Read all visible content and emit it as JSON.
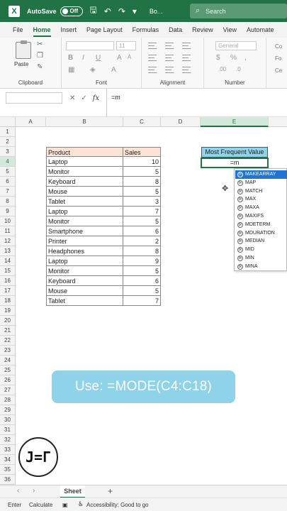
{
  "titlebar": {
    "autosave_label": "AutoSave",
    "autosave_state": "Off",
    "filename": "Bo...",
    "search_placeholder": "Search"
  },
  "menu": {
    "items": [
      {
        "label": "File"
      },
      {
        "label": "Home"
      },
      {
        "label": "Insert"
      },
      {
        "label": "Page Layout"
      },
      {
        "label": "Formulas"
      },
      {
        "label": "Data"
      },
      {
        "label": "Review"
      },
      {
        "label": "View"
      },
      {
        "label": "Automate"
      }
    ]
  },
  "ribbon": {
    "paste_label": "Paste",
    "clipboard_label": "Clipboard",
    "font_label": "Font",
    "font_size": "11",
    "bold": "B",
    "italic": "I",
    "underline": "U",
    "alignment_label": "Alignment",
    "number_format": "General",
    "number_label": "Number",
    "styles_clipped": [
      "Co",
      "Fo",
      "Ce"
    ]
  },
  "formula_bar": {
    "cancel_glyph": "✕",
    "enter_glyph": "✓",
    "fx_label": "fx",
    "content": "=m"
  },
  "columns": [
    "A",
    "B",
    "C",
    "D",
    "E"
  ],
  "rows": [
    "1",
    "2",
    "3",
    "4",
    "5",
    "6",
    "7",
    "8",
    "9",
    "10",
    "11",
    "12",
    "13",
    "14",
    "15",
    "16",
    "17",
    "18",
    "19",
    "20",
    "21",
    "22",
    "23",
    "24",
    "25",
    "26",
    "27",
    "28",
    "29",
    "30",
    "31",
    "32",
    "33",
    "34",
    "35",
    "36"
  ],
  "table": {
    "headers": [
      "Product",
      "Sales"
    ],
    "rows": [
      [
        "Laptop",
        "10"
      ],
      [
        "Monitor",
        "5"
      ],
      [
        "Keyboard",
        "8"
      ],
      [
        "Mouse",
        "5"
      ],
      [
        "Tablet",
        "3"
      ],
      [
        "Laptop",
        "7"
      ],
      [
        "Monitor",
        "5"
      ],
      [
        "Smartphone",
        "6"
      ],
      [
        "Printer",
        "2"
      ],
      [
        "Headphones",
        "8"
      ],
      [
        "Laptop",
        "9"
      ],
      [
        "Monitor",
        "5"
      ],
      [
        "Keyboard",
        "6"
      ],
      [
        "Mouse",
        "5"
      ],
      [
        "Tablet",
        "7"
      ]
    ]
  },
  "mfv": {
    "header": "Most Frequent Value",
    "cell_value": "=m"
  },
  "autocomplete": {
    "items": [
      "MAKEARRAY",
      "MAP",
      "MATCH",
      "MAX",
      "MAXA",
      "MAXIFS",
      "MDETERM",
      "MDURATION",
      "MEDIAN",
      "MID",
      "MIN",
      "MINA"
    ],
    "selected_index": 0
  },
  "banner_text": "Use: =MODE(C4:C18)",
  "logo_text": "J=Γ",
  "sheet": {
    "tab_label": "Sheet",
    "add_glyph": "+"
  },
  "status": {
    "mode": "Enter",
    "calc": "Calculate",
    "accessibility": "Accessibility: Good to go"
  },
  "colors": {
    "excel_green": "#217346",
    "header_fill": "#fbe3d6",
    "mfv_fill": "#8fd3ea",
    "autocomplete_selected": "#1f74d6"
  }
}
